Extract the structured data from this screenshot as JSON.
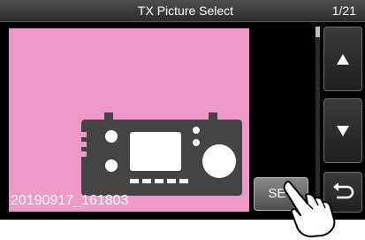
{
  "header": {
    "title": "TX Picture Select",
    "page_indicator": "1/21"
  },
  "preview": {
    "filename": "20190917_161803",
    "background_color": "#ee99c8"
  },
  "controls": {
    "set_label": "SET",
    "up_icon": "triangle-up-icon",
    "down_icon": "triangle-down-icon",
    "back_icon": "return-arrow-icon"
  }
}
